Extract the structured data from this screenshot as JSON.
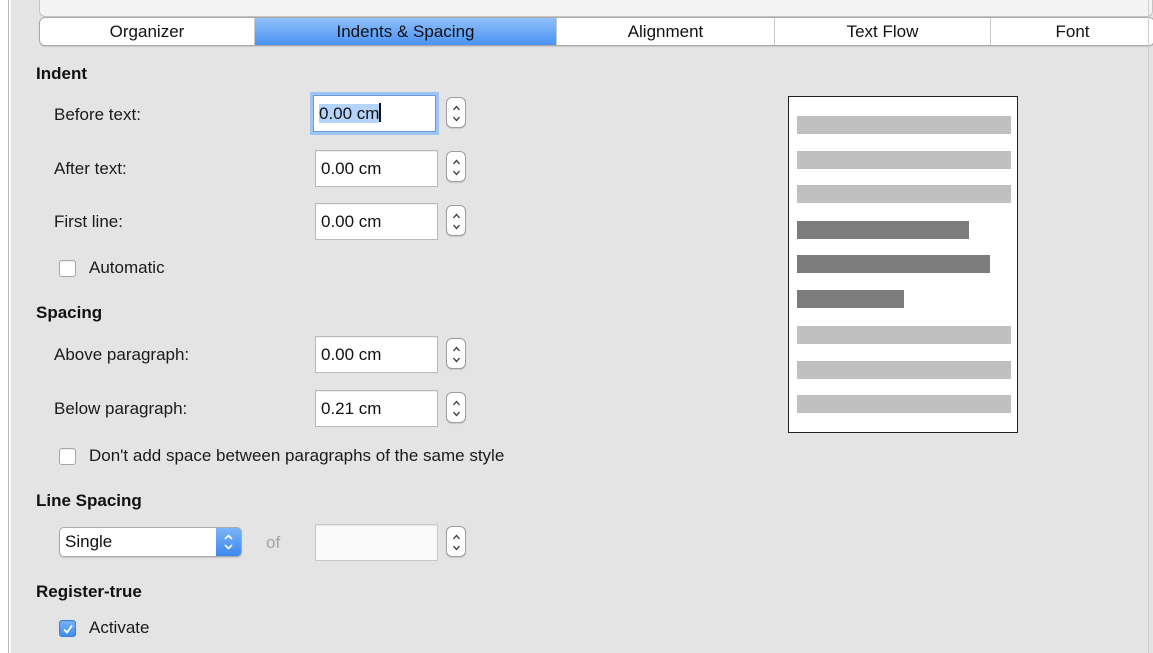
{
  "tabs": [
    {
      "label": "Organizer",
      "active": false
    },
    {
      "label": "Indents & Spacing",
      "active": true
    },
    {
      "label": "Alignment",
      "active": false
    },
    {
      "label": "Text Flow",
      "active": false
    },
    {
      "label": "Font",
      "active": false
    }
  ],
  "indent": {
    "title": "Indent",
    "before_text": {
      "label": "Before text:",
      "value": "0.00 cm"
    },
    "after_text": {
      "label": "After text:",
      "value": "0.00 cm"
    },
    "first_line": {
      "label": "First line:",
      "value": "0.00 cm"
    },
    "automatic": {
      "label": "Automatic",
      "checked": false
    }
  },
  "spacing": {
    "title": "Spacing",
    "above_paragraph": {
      "label": "Above paragraph:",
      "value": "0.00 cm"
    },
    "below_paragraph": {
      "label": "Below paragraph:",
      "value": "0.21 cm"
    },
    "dont_add_space": {
      "label": "Don't add space between paragraphs of the same style",
      "checked": false
    }
  },
  "line_spacing": {
    "title": "Line Spacing",
    "selected": "Single",
    "of_label": "of",
    "of_value": ""
  },
  "register_true": {
    "title": "Register-true",
    "activate": {
      "label": "Activate",
      "checked": true
    }
  },
  "colors": {
    "active_tab": "#4b93f3",
    "preview_light_line": "#c0c0c0",
    "preview_dark_line": "#7c7c7c",
    "dialog_background": "#e4e4e4"
  }
}
